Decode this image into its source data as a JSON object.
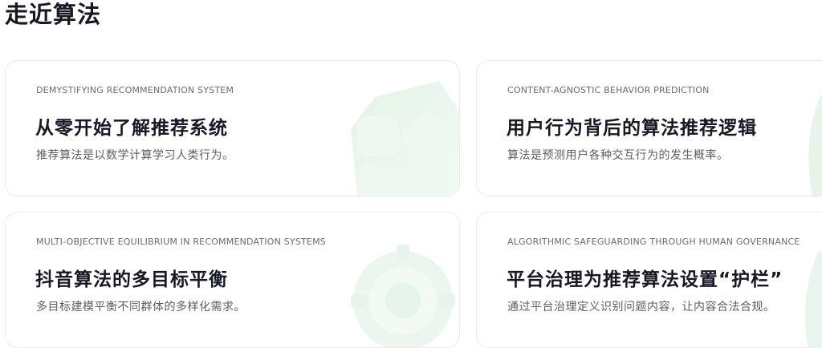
{
  "section": {
    "title": "走近算法"
  },
  "cards": [
    {
      "eyebrow": "DEMYSTIFYING RECOMMENDATION SYSTEM",
      "title": "从零开始了解推荐系统",
      "description": "推荐算法是以数学计算学习人类行为。",
      "icon": "app-grid-icon",
      "accent": "#e8f5ec"
    },
    {
      "eyebrow": "CONTENT-AGNOSTIC BEHAVIOR PREDICTION",
      "title": "用户行为背后的算法推荐逻辑",
      "description": "算法是预测用户各种交互行为的发生概率。",
      "icon": "leaf-icon",
      "accent": "#e8f5ec"
    },
    {
      "eyebrow": "MULTI-OBJECTIVE EQUILIBRIUM IN RECOMMENDATION SYSTEMS",
      "title": "抖音算法的多目标平衡",
      "description": "多目标建模平衡不同群体的多样化需求。",
      "icon": "gear-icon",
      "accent": "#e8f5ec"
    },
    {
      "eyebrow": "ALGORITHMIC SAFEGUARDING THROUGH HUMAN GOVERNANCE",
      "title": "平台治理为推荐算法设置“护栏”",
      "description": "通过平台治理定义识别问题内容，让内容合法合规。",
      "icon": "shield-icon",
      "accent": "#e8f5ec"
    }
  ]
}
